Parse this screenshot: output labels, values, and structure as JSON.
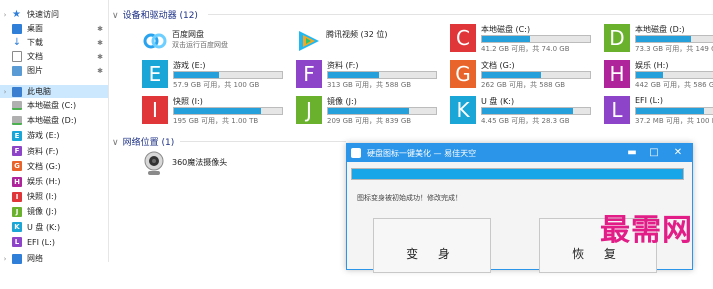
{
  "nav": {
    "quick_access": "快速访问",
    "pinned": [
      {
        "label": "桌面",
        "icon": "desktop-icon"
      },
      {
        "label": "下载",
        "icon": "download-icon"
      },
      {
        "label": "文档",
        "icon": "document-icon"
      },
      {
        "label": "图片",
        "icon": "pictures-icon"
      }
    ],
    "this_pc": "此电脑",
    "drives": [
      {
        "label": "本地磁盘 (C:)",
        "letter": "",
        "type": "disk"
      },
      {
        "label": "本地磁盘 (D:)",
        "letter": "",
        "type": "disk"
      },
      {
        "label": "游戏 (E:)",
        "letter": "E",
        "color": "#1aa6d6"
      },
      {
        "label": "资料 (F:)",
        "letter": "F",
        "color": "#8e44c8"
      },
      {
        "label": "文档 (G:)",
        "letter": "G",
        "color": "#e8642b"
      },
      {
        "label": "娱乐 (H:)",
        "letter": "H",
        "color": "#b0249b"
      },
      {
        "label": "快照 (I:)",
        "letter": "I",
        "color": "#e0363a"
      },
      {
        "label": "镜像 (J:)",
        "letter": "J",
        "color": "#6ab22e"
      },
      {
        "label": "U 盘 (K:)",
        "letter": "K",
        "color": "#1aa6d6"
      },
      {
        "label": "EFI (L:)",
        "letter": "L",
        "color": "#8e44c8"
      }
    ],
    "network": "网络"
  },
  "devices_group": "设备和驱动器 (12)",
  "apps": [
    {
      "name": "百度网盘",
      "sub": "双击运行百度网盘",
      "icon": "baidu-netdisk-icon"
    },
    {
      "name": "腾讯视频 (32 位)",
      "sub": "",
      "icon": "tencent-video-icon"
    }
  ],
  "drive_tiles": [
    {
      "letter": "C",
      "name": "本地磁盘 (C:)",
      "free": "41.2 GB 可用，共 74.0 GB",
      "used": 0.44,
      "color": "#e0363a"
    },
    {
      "letter": "D",
      "name": "本地磁盘 (D:)",
      "free": "73.3 GB 可用，共 149 GB",
      "used": 0.51,
      "color": "#6ab22e"
    },
    {
      "letter": "E",
      "name": "游戏 (E:)",
      "free": "57.9 GB 可用，共 100 GB",
      "used": 0.42,
      "color": "#1aa6d6"
    },
    {
      "letter": "F",
      "name": "资料 (F:)",
      "free": "313 GB 可用，共 588 GB",
      "used": 0.47,
      "color": "#8e44c8"
    },
    {
      "letter": "G",
      "name": "文档 (G:)",
      "free": "262 GB 可用，共 588 GB",
      "used": 0.55,
      "color": "#e8642b"
    },
    {
      "letter": "H",
      "name": "娱乐 (H:)",
      "free": "442 GB 可用，共 586 GB",
      "used": 0.25,
      "color": "#b0249b"
    },
    {
      "letter": "I",
      "name": "快照 (I:)",
      "free": "195 GB 可用，共 1.00 TB",
      "used": 0.81,
      "color": "#e0363a"
    },
    {
      "letter": "J",
      "name": "镜像 (J:)",
      "free": "209 GB 可用，共 839 GB",
      "used": 0.75,
      "color": "#6ab22e"
    },
    {
      "letter": "K",
      "name": "U 盘 (K:)",
      "free": "4.45 GB 可用，共 28.3 GB",
      "used": 0.84,
      "color": "#1aa6d6"
    },
    {
      "letter": "L",
      "name": "EFI (L:)",
      "free": "37.2 MB 可用，共 100 MB",
      "used": 0.63,
      "color": "#8e44c8"
    }
  ],
  "network_group": "网络位置 (1)",
  "camera": "360魔法摄像头",
  "dialog": {
    "title": "硬盘图标一键美化 — 易佳天空",
    "progress": 1.0,
    "status": "图标变身被初始成功！修改完成！",
    "btn_transform": "变 身",
    "btn_restore": "恢 复",
    "min": "▬",
    "max": "□",
    "close": "✕"
  },
  "watermark": "最需网"
}
